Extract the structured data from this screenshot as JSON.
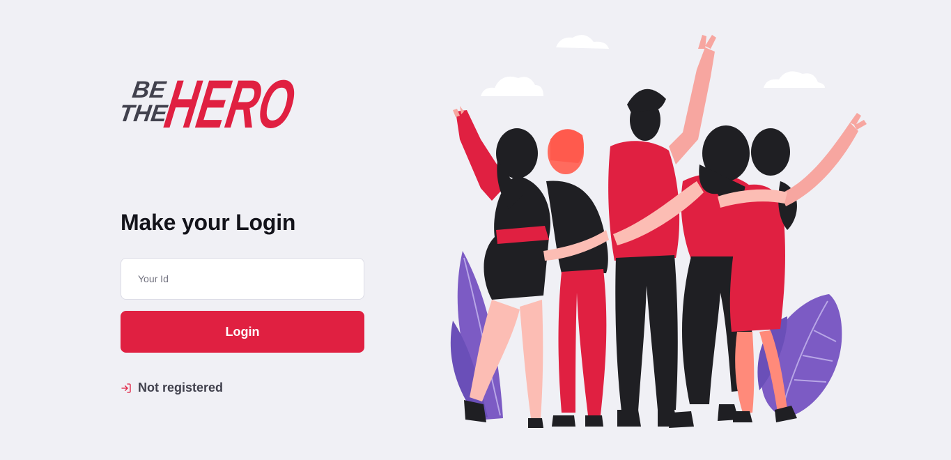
{
  "logo": {
    "line1": "BE",
    "line2": "THE",
    "brand": "HERO"
  },
  "login": {
    "title": "Make your Login",
    "id_placeholder": "Your Id",
    "id_value": "",
    "button_label": "Login",
    "register_link": "Not registered"
  },
  "colors": {
    "brand_red": "#e02041",
    "background": "#f0f0f5",
    "dark_text": "#41414d"
  },
  "icons": {
    "register": "log-in-icon"
  },
  "illustration": {
    "name": "group-of-friends-waving"
  }
}
